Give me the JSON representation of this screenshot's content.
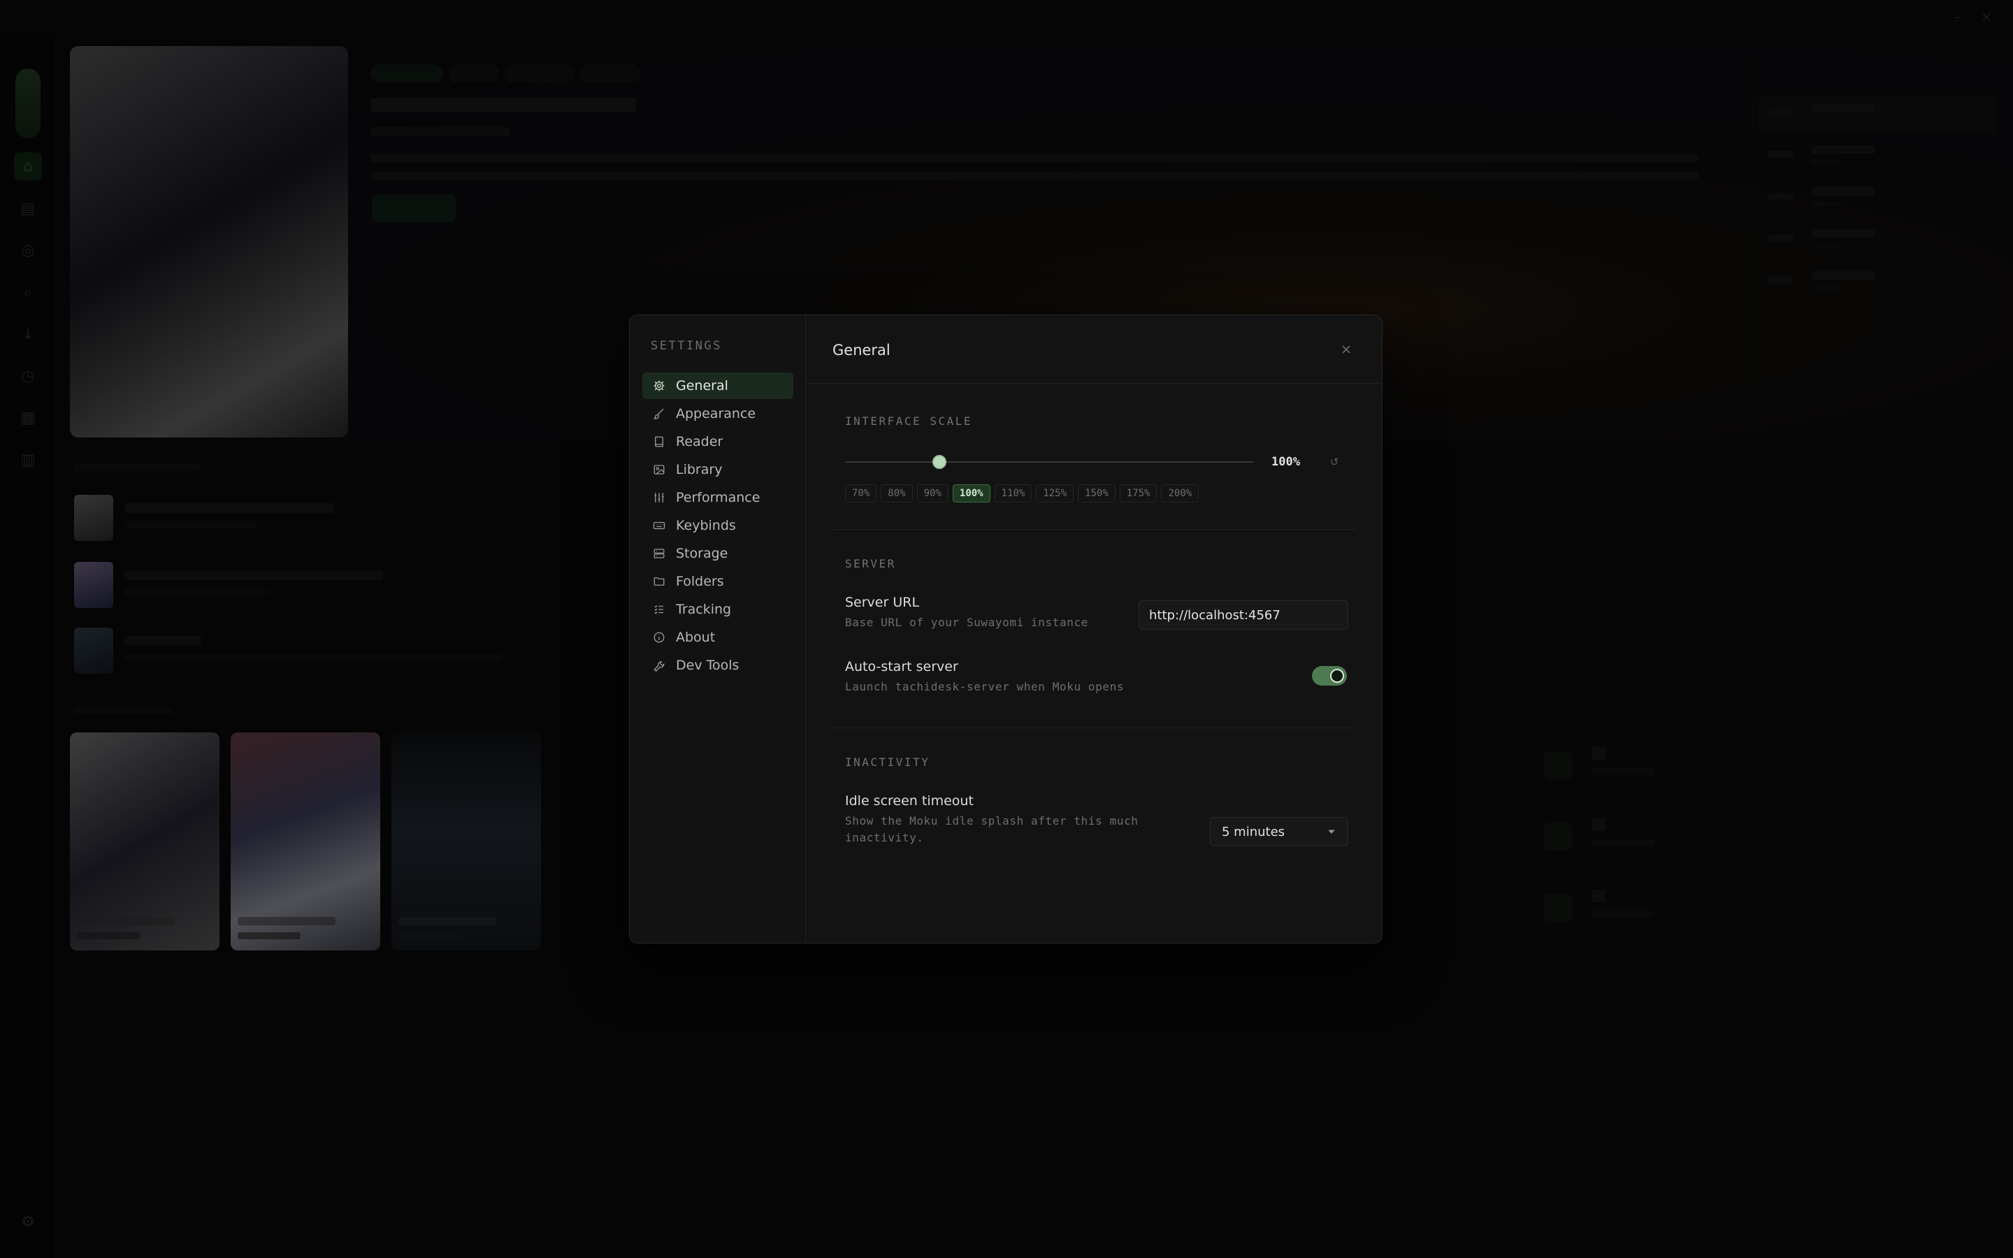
{
  "settings": {
    "heading": "SETTINGS",
    "items": [
      {
        "label": "General",
        "icon": "gear-icon",
        "active": true
      },
      {
        "label": "Appearance",
        "icon": "brush-icon"
      },
      {
        "label": "Reader",
        "icon": "book-icon"
      },
      {
        "label": "Library",
        "icon": "image-icon"
      },
      {
        "label": "Performance",
        "icon": "sliders-icon"
      },
      {
        "label": "Keybinds",
        "icon": "keyboard-icon"
      },
      {
        "label": "Storage",
        "icon": "storage-icon"
      },
      {
        "label": "Folders",
        "icon": "folder-icon"
      },
      {
        "label": "Tracking",
        "icon": "list-icon"
      },
      {
        "label": "About",
        "icon": "info-icon"
      },
      {
        "label": "Dev Tools",
        "icon": "wrench-icon"
      }
    ]
  },
  "panel": {
    "title": "General",
    "close_icon": "close-icon",
    "interface_scale": {
      "section": "INTERFACE SCALE",
      "value_label": "100%",
      "value": 100,
      "min": 70,
      "max": 200,
      "presets": [
        "70%",
        "80%",
        "90%",
        "100%",
        "110%",
        "125%",
        "150%",
        "175%",
        "200%"
      ],
      "selected": "100%"
    },
    "server": {
      "section": "SERVER",
      "url_label": "Server URL",
      "url_desc": "Base URL of your Suwayomi instance",
      "url_value": "http://localhost:4567",
      "autostart_label": "Auto-start server",
      "autostart_desc": "Launch tachidesk-server when Moku opens",
      "autostart_on": true
    },
    "inactivity": {
      "section": "INACTIVITY",
      "idle_label": "Idle screen timeout",
      "idle_desc_1": "Show the Moku idle splash after this much",
      "idle_desc_2": "inactivity.",
      "idle_value": "5 minutes"
    }
  },
  "colors": {
    "accent": "#4e7a52",
    "active_bg": "#1b2a1e",
    "modal_bg": "#131313"
  }
}
